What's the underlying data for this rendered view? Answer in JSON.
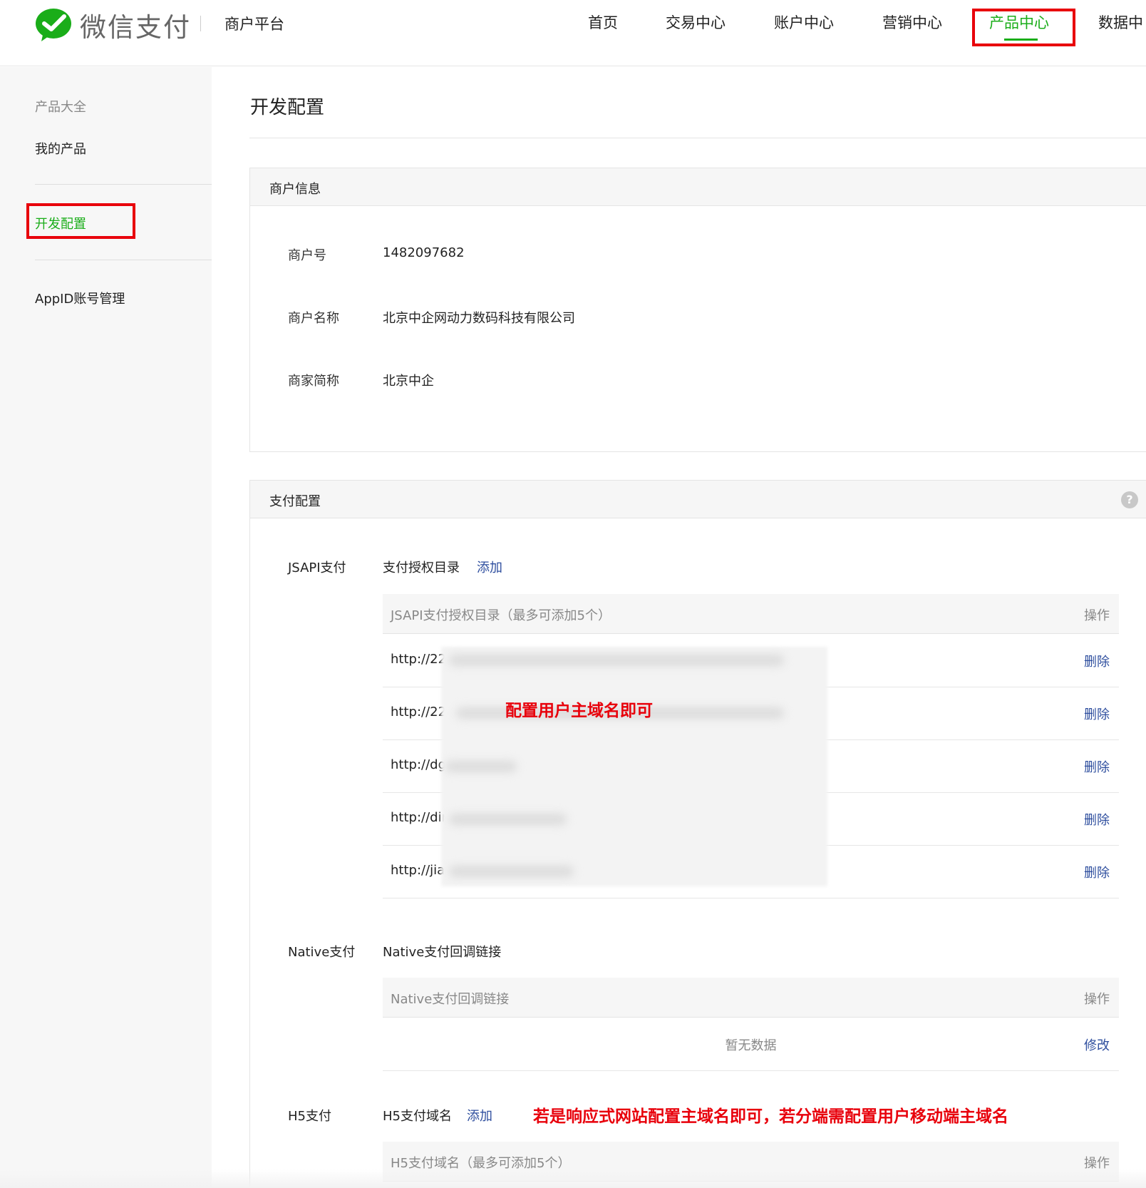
{
  "header": {
    "logo_text": "微信支付",
    "platform": "商户平台",
    "nav": [
      {
        "label": "首页"
      },
      {
        "label": "交易中心"
      },
      {
        "label": "账户中心"
      },
      {
        "label": "营销中心"
      },
      {
        "label": "产品中心",
        "active": true
      },
      {
        "label": "数据中"
      }
    ]
  },
  "sidebar": {
    "items": [
      {
        "label": "产品大全"
      },
      {
        "label": "我的产品"
      },
      {
        "label": "开发配置",
        "active": true
      },
      {
        "label": "AppID账号管理"
      }
    ]
  },
  "page": {
    "title": "开发配置"
  },
  "merchant_info": {
    "heading": "商户信息",
    "fields": [
      {
        "label": "商户号",
        "value": "1482097682"
      },
      {
        "label": "商户名称",
        "value": "北京中企网动力数码科技有限公司"
      },
      {
        "label": "商家简称",
        "value": "北京中企"
      }
    ]
  },
  "pay_config": {
    "heading": "支付配置",
    "help_icon": "?",
    "jsapi": {
      "label": "JSAPI支付",
      "sub_label": "支付授权目录",
      "add_link": "添加",
      "table": {
        "col_name": "JSAPI支付授权目录（最多可添加5个）",
        "col_action": "操作",
        "rows": [
          {
            "url": "http://22",
            "action": "删除"
          },
          {
            "url": "http://22",
            "action": "删除"
          },
          {
            "url": "http://dg",
            "action": "删除"
          },
          {
            "url": "http://dir",
            "action": "删除"
          },
          {
            "url": "http://jiar",
            "action": "删除"
          }
        ]
      }
    },
    "native": {
      "label": "Native支付",
      "sub_label": "Native支付回调链接",
      "table": {
        "col_name": "Native支付回调链接",
        "col_action": "操作",
        "empty_text": "暂无数据",
        "action": "修改"
      }
    },
    "h5": {
      "label": "H5支付",
      "sub_label": "H5支付域名",
      "add_link": "添加",
      "table": {
        "col_name": "H5支付域名（最多可添加5个）",
        "col_action": "操作"
      }
    }
  },
  "annotations": {
    "jsapi_note": "配置用户主域名即可",
    "h5_note": "若是响应式网站配置主域名即可，若分端需配置用户移动端主域名"
  },
  "colors": {
    "brand_green": "#1aad19",
    "link_blue": "#2e4e9e",
    "annotation_red": "#e8000b"
  }
}
